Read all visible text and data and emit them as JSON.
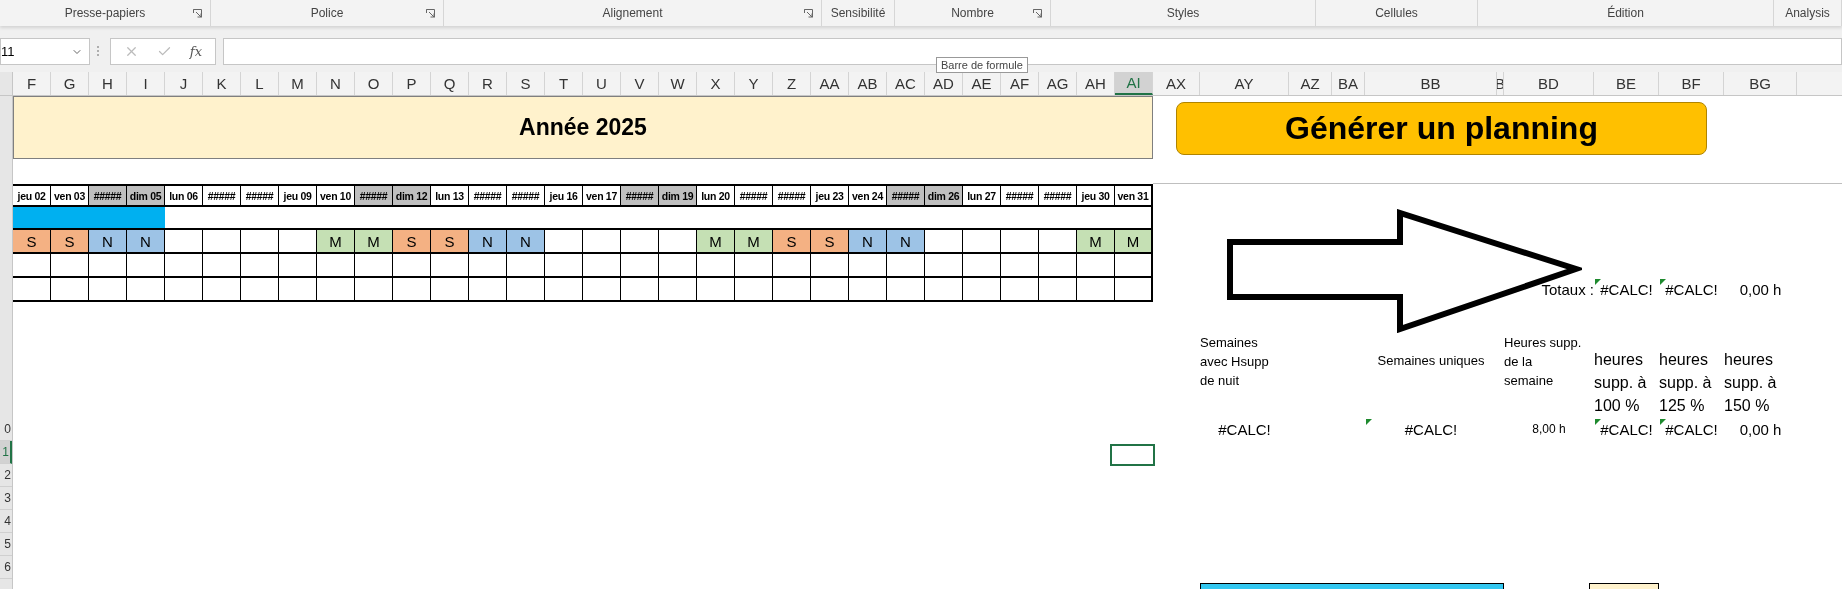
{
  "ribbon": {
    "groups": [
      {
        "label": "Presse-papiers",
        "launcher": true
      },
      {
        "label": "Police",
        "launcher": true
      },
      {
        "label": "Alignement",
        "launcher": true
      },
      {
        "label": "Sensibilité",
        "launcher": false
      },
      {
        "label": "Nombre",
        "launcher": true
      },
      {
        "label": "Styles",
        "launcher": false
      },
      {
        "label": "Cellules",
        "launcher": false
      },
      {
        "label": "Édition",
        "launcher": false
      },
      {
        "label": "Analysis",
        "launcher": false
      }
    ]
  },
  "formula_bar": {
    "name_box": "11",
    "function_label": "fx",
    "tooltip": "Barre de formule"
  },
  "columns": [
    {
      "label": "F",
      "selected": false
    },
    {
      "label": "G",
      "selected": false
    },
    {
      "label": "H",
      "selected": false
    },
    {
      "label": "I",
      "selected": false
    },
    {
      "label": "J",
      "selected": false
    },
    {
      "label": "K",
      "selected": false
    },
    {
      "label": "L",
      "selected": false
    },
    {
      "label": "M",
      "selected": false
    },
    {
      "label": "N",
      "selected": false
    },
    {
      "label": "O",
      "selected": false
    },
    {
      "label": "P",
      "selected": false
    },
    {
      "label": "Q",
      "selected": false
    },
    {
      "label": "R",
      "selected": false
    },
    {
      "label": "S",
      "selected": false
    },
    {
      "label": "T",
      "selected": false
    },
    {
      "label": "U",
      "selected": false
    },
    {
      "label": "V",
      "selected": false
    },
    {
      "label": "W",
      "selected": false
    },
    {
      "label": "X",
      "selected": false
    },
    {
      "label": "Y",
      "selected": false
    },
    {
      "label": "Z",
      "selected": false
    },
    {
      "label": "AA",
      "selected": false
    },
    {
      "label": "AB",
      "selected": false
    },
    {
      "label": "AC",
      "selected": false
    },
    {
      "label": "AD",
      "selected": false
    },
    {
      "label": "AE",
      "selected": false
    },
    {
      "label": "AF",
      "selected": false
    },
    {
      "label": "AG",
      "selected": false
    },
    {
      "label": "AH",
      "selected": false
    },
    {
      "label": "AI",
      "selected": true
    },
    {
      "label": "AX",
      "selected": false
    },
    {
      "label": "AY",
      "selected": false
    },
    {
      "label": "AZ",
      "selected": false
    },
    {
      "label": "BA",
      "selected": false
    },
    {
      "label": "BB",
      "selected": false
    },
    {
      "label": "B",
      "selected": false
    },
    {
      "label": "BD",
      "selected": false
    },
    {
      "label": "BE",
      "selected": false
    },
    {
      "label": "BF",
      "selected": false
    },
    {
      "label": "BG",
      "selected": false
    }
  ],
  "row_headers": [
    {
      "label": "0",
      "selected": false
    },
    {
      "label": "1",
      "selected": true
    },
    {
      "label": "2",
      "selected": false
    },
    {
      "label": "3",
      "selected": false
    },
    {
      "label": "4",
      "selected": false
    },
    {
      "label": "5",
      "selected": false
    },
    {
      "label": "6",
      "selected": false
    }
  ],
  "sheet": {
    "banner": "Année 2025",
    "generate_button": "Générer un planning",
    "dates": [
      {
        "label": "jeu 02",
        "weekend": false
      },
      {
        "label": "ven 03",
        "weekend": false
      },
      {
        "label": "#####",
        "weekend": true
      },
      {
        "label": "dim 05",
        "weekend": true
      },
      {
        "label": "lun 06",
        "weekend": false
      },
      {
        "label": "#####",
        "weekend": false
      },
      {
        "label": "#####",
        "weekend": false
      },
      {
        "label": "jeu 09",
        "weekend": false
      },
      {
        "label": "ven 10",
        "weekend": false
      },
      {
        "label": "#####",
        "weekend": true
      },
      {
        "label": "dim 12",
        "weekend": true
      },
      {
        "label": "lun 13",
        "weekend": false
      },
      {
        "label": "#####",
        "weekend": false
      },
      {
        "label": "#####",
        "weekend": false
      },
      {
        "label": "jeu 16",
        "weekend": false
      },
      {
        "label": "ven 17",
        "weekend": false
      },
      {
        "label": "#####",
        "weekend": true
      },
      {
        "label": "dim 19",
        "weekend": true
      },
      {
        "label": "lun 20",
        "weekend": false
      },
      {
        "label": "#####",
        "weekend": false
      },
      {
        "label": "#####",
        "weekend": false
      },
      {
        "label": "jeu 23",
        "weekend": false
      },
      {
        "label": "ven 24",
        "weekend": false
      },
      {
        "label": "#####",
        "weekend": true
      },
      {
        "label": "dim 26",
        "weekend": true
      },
      {
        "label": "lun 27",
        "weekend": false
      },
      {
        "label": "#####",
        "weekend": false
      },
      {
        "label": "#####",
        "weekend": false
      },
      {
        "label": "jeu 30",
        "weekend": false
      },
      {
        "label": "ven 31",
        "weekend": false
      }
    ],
    "period_bar": {
      "level": 0.1333
    },
    "shifts": [
      {
        "kind": "shift",
        "text": "S",
        "color": "#f4b183"
      },
      {
        "kind": "shift",
        "text": "S",
        "color": "#f4b183"
      },
      {
        "kind": "shift",
        "text": "N",
        "color": "#9dc3e6"
      },
      {
        "kind": "shift",
        "text": "N",
        "color": "#9dc3e6"
      },
      {
        "kind": "empty"
      },
      {
        "kind": "empty"
      },
      {
        "kind": "empty"
      },
      {
        "kind": "empty"
      },
      {
        "kind": "shift",
        "text": "M",
        "color": "#c5e0b4"
      },
      {
        "kind": "shift",
        "text": "M",
        "color": "#c5e0b4"
      },
      {
        "kind": "shift",
        "text": "S",
        "color": "#f4b183"
      },
      {
        "kind": "shift",
        "text": "S",
        "color": "#f4b183"
      },
      {
        "kind": "shift",
        "text": "N",
        "color": "#9dc3e6"
      },
      {
        "kind": "shift",
        "text": "N",
        "color": "#9dc3e6"
      },
      {
        "kind": "empty"
      },
      {
        "kind": "empty"
      },
      {
        "kind": "empty"
      },
      {
        "kind": "empty"
      },
      {
        "kind": "shift",
        "text": "M",
        "color": "#c5e0b4"
      },
      {
        "kind": "shift",
        "text": "M",
        "color": "#c5e0b4"
      },
      {
        "kind": "shift",
        "text": "S",
        "color": "#f4b183"
      },
      {
        "kind": "shift",
        "text": "S",
        "color": "#f4b183"
      },
      {
        "kind": "shift",
        "text": "N",
        "color": "#9dc3e6"
      },
      {
        "kind": "shift",
        "text": "N",
        "color": "#9dc3e6"
      },
      {
        "kind": "empty"
      },
      {
        "kind": "empty"
      },
      {
        "kind": "empty"
      },
      {
        "kind": "empty"
      },
      {
        "kind": "shift",
        "text": "M",
        "color": "#c5e0b4"
      },
      {
        "kind": "shift",
        "text": "M",
        "color": "#c5e0b4"
      }
    ],
    "totals": {
      "label": "Totaux :",
      "cells": [
        {
          "text": "#CALC!",
          "error_flag": true
        },
        {
          "text": "#CALC!",
          "error_flag": true
        },
        {
          "text": "0,00 h",
          "error_flag": false
        }
      ]
    },
    "summary": {
      "headers": [
        "Semaines avec Hsupp de nuit",
        "Semaines uniques",
        "Heures supp. de la semaine",
        "heures supp. à 100 %",
        "heures supp. à 125 %",
        "heures supp. à 150 %"
      ],
      "values": [
        {
          "text": "#CALC!",
          "error_flag": false
        },
        {
          "text": "#CALC!",
          "error_flag": true
        },
        {
          "text": "8,00 h",
          "error_flag": false
        },
        {
          "text": "#CALC!",
          "error_flag": true
        },
        {
          "text": "#CALC!",
          "error_flag": true
        },
        {
          "text": "0,00 h",
          "error_flag": false
        }
      ]
    }
  }
}
